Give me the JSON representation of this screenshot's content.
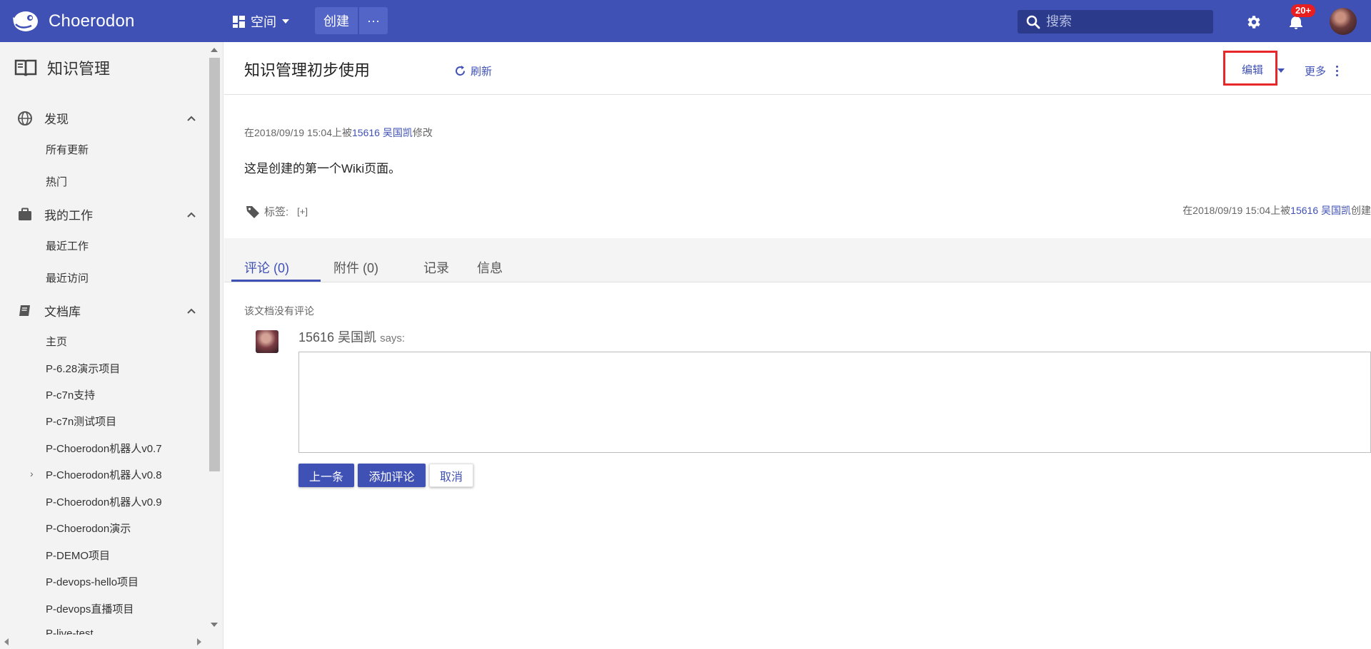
{
  "topbar": {
    "brand": "Choerodon",
    "space_label": "空间",
    "create_label": "创建",
    "more_label": "···",
    "search_placeholder": "搜索",
    "notification_count": "20+"
  },
  "sidebar": {
    "title": "知识管理",
    "sections": [
      {
        "label": "发现",
        "items": [
          "所有更新",
          "热门"
        ]
      },
      {
        "label": "我的工作",
        "items": [
          "最近工作",
          "最近访问"
        ]
      },
      {
        "label": "文档库",
        "items": [
          "主页",
          "P-6.28演示项目",
          "P-c7n支持",
          "P-c7n测试项目",
          "P-Choerodon机器人v0.7",
          "P-Choerodon机器人v0.8",
          "P-Choerodon机器人v0.9",
          "P-Choerodon演示",
          "P-DEMO项目",
          "P-devops-hello项目",
          "P-devops直播项目",
          "P-live-test"
        ]
      }
    ]
  },
  "page": {
    "title": "知识管理初步使用",
    "refresh_label": "刷新",
    "edit_label": "编辑",
    "more_label": "更多",
    "modified_prefix": "在2018/09/19 15:04上被",
    "modified_user": "15616 吴国凯",
    "modified_suffix": "修改",
    "body": "这是创建的第一个Wiki页面。",
    "tags_label": "标签:",
    "tags_add": "[+]",
    "created_prefix": "在2018/09/19 15:04上被",
    "created_user": "15616 吴国凯",
    "created_suffix": "创建"
  },
  "tabs": [
    {
      "label": "评论  (0)",
      "active": true
    },
    {
      "label": "附件  (0)",
      "active": false
    },
    {
      "label": "记录",
      "active": false
    },
    {
      "label": "信息",
      "active": false
    }
  ],
  "comments": {
    "empty_text": "该文档没有评论",
    "author": "15616 吴国凯",
    "says": "says:",
    "prev_button": "上一条",
    "add_button": "添加评论",
    "cancel_button": "取消"
  },
  "colors": {
    "primary": "#3f51b5",
    "highlight_box": "#e8272a",
    "badge": "#e91e1e"
  }
}
